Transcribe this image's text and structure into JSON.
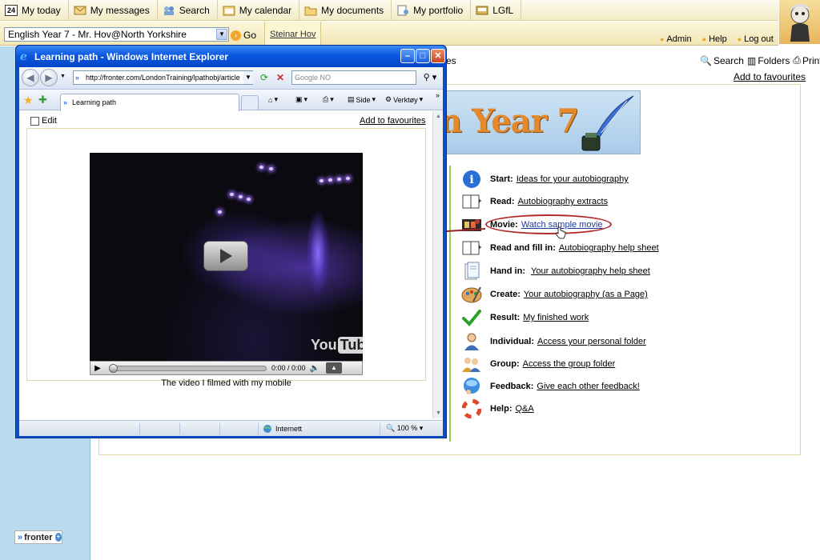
{
  "topnav": {
    "items": [
      {
        "label": "My today",
        "icon": "calendar-day-icon"
      },
      {
        "label": "My messages",
        "icon": "envelope-icon"
      },
      {
        "label": "Search",
        "icon": "search-people-icon"
      },
      {
        "label": "My calendar",
        "icon": "calendar-icon"
      },
      {
        "label": "My documents",
        "icon": "folder-icon"
      },
      {
        "label": "My portfolio",
        "icon": "portfolio-icon"
      },
      {
        "label": "LGfL",
        "icon": "lgfl-icon"
      }
    ],
    "today_number": "24"
  },
  "class_select": {
    "value": "English Year 7 - Mr. Hov@North Yorkshire"
  },
  "go_label": "Go",
  "user_link": "Steinar Hov",
  "util": {
    "admin": "Admin",
    "help": "Help",
    "logout": "Log out"
  },
  "toolbar": {
    "search": "Search",
    "folders": "Folders",
    "print": "Print"
  },
  "add_favourites": "Add to favourites",
  "banner": {
    "title_fragment": "n Year 7"
  },
  "partial_text": "es",
  "learning_path": [
    {
      "label": "Start:",
      "link": "Ideas for your autobiography",
      "icon": "info-icon"
    },
    {
      "label": "Read:",
      "link": "Autobiography extracts",
      "icon": "book-icon"
    },
    {
      "label": "Movie:",
      "link": "Watch sample movie",
      "icon": "film-icon"
    },
    {
      "label": "Read and fill in:",
      "link": "Autobiography help sheet",
      "icon": "book-icon"
    },
    {
      "label": "Hand in:",
      "link": "Your autobiography help sheet",
      "icon": "document-icon"
    },
    {
      "label": "Create:",
      "link": "Your autobiography (as a Page)",
      "icon": "palette-icon"
    },
    {
      "label": "Result:",
      "link": "My finished work",
      "icon": "checkmark-icon"
    },
    {
      "label": "Individual:",
      "link": "Access your personal folder",
      "icon": "person-icon"
    },
    {
      "label": "Group:",
      "link": "Access the group folder",
      "icon": "group-icon"
    },
    {
      "label": "Feedback:",
      "link": "Give each other feedback!",
      "icon": "feedback-icon"
    },
    {
      "label": "Help:",
      "link": "Q&A",
      "icon": "lifebuoy-icon"
    }
  ],
  "fronter_logo": "fronter",
  "ie": {
    "title": "Learning path - Windows Internet Explorer",
    "url": "http://fronter.com/LondonTraining/lpathobj/article",
    "search_placeholder": "Google NO",
    "tab_label": "Learning path",
    "side_label": "Side",
    "tools_label": "Verktøy",
    "edit_label": "Edit",
    "add_favourites": "Add to favourites",
    "video_time": "0:00 / 0:00",
    "youtube_you": "You",
    "youtube_tube": "Tube",
    "caption": "The video I filmed with my mobile",
    "status_zone": "Internett",
    "zoom": "100 %"
  },
  "colors": {
    "highlight": "#b12b2b",
    "ie_blue": "#0b58e0",
    "sidebar": "#b9dbee"
  }
}
